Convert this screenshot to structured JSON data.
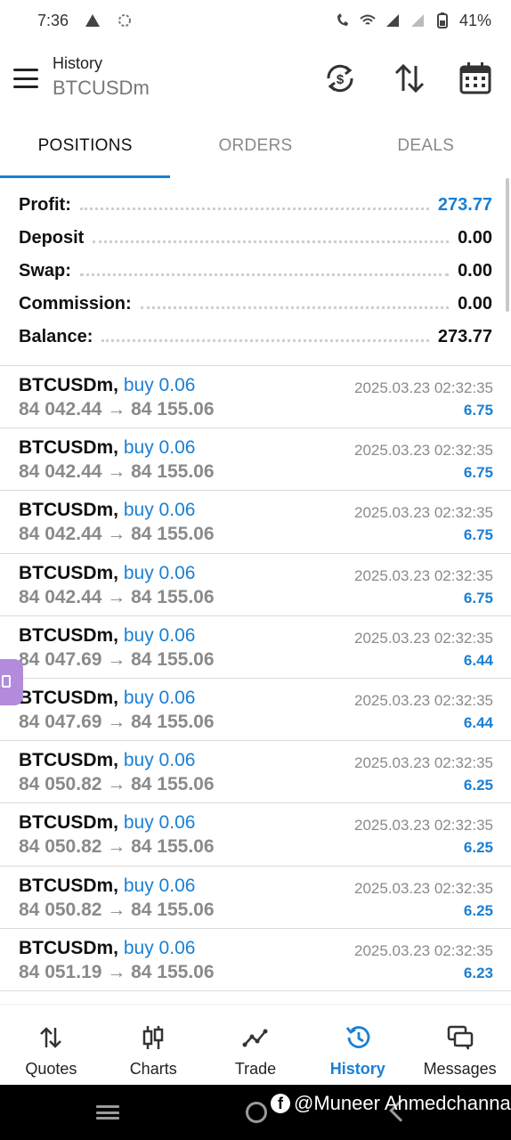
{
  "status_bar": {
    "time": "7:36",
    "battery": "41%"
  },
  "app_bar": {
    "subtitle": "History",
    "title": "BTCUSDm"
  },
  "tabs": [
    {
      "label": "POSITIONS",
      "active": true
    },
    {
      "label": "ORDERS",
      "active": false
    },
    {
      "label": "DEALS",
      "active": false
    }
  ],
  "summary": {
    "profit_label": "Profit:",
    "profit_value": "273.77",
    "deposit_label": "Deposit",
    "deposit_value": "0.00",
    "swap_label": "Swap:",
    "swap_value": "0.00",
    "commission_label": "Commission:",
    "commission_value": "0.00",
    "balance_label": "Balance:",
    "balance_value": "273.77"
  },
  "trades": [
    {
      "symbol": "BTCUSDm,",
      "side": "buy 0.06",
      "prices": "84 042.44 → 84 155.06",
      "date": "2025.03.23 02:32:35",
      "profit": "6.75"
    },
    {
      "symbol": "BTCUSDm,",
      "side": "buy 0.06",
      "prices": "84 042.44 → 84 155.06",
      "date": "2025.03.23 02:32:35",
      "profit": "6.75"
    },
    {
      "symbol": "BTCUSDm,",
      "side": "buy 0.06",
      "prices": "84 042.44 → 84 155.06",
      "date": "2025.03.23 02:32:35",
      "profit": "6.75"
    },
    {
      "symbol": "BTCUSDm,",
      "side": "buy 0.06",
      "prices": "84 042.44 → 84 155.06",
      "date": "2025.03.23 02:32:35",
      "profit": "6.75"
    },
    {
      "symbol": "BTCUSDm,",
      "side": "buy 0.06",
      "prices": "84 047.69 → 84 155.06",
      "date": "2025.03.23 02:32:35",
      "profit": "6.44"
    },
    {
      "symbol": "BTCUSDm,",
      "side": "buy 0.06",
      "prices": "84 047.69 → 84 155.06",
      "date": "2025.03.23 02:32:35",
      "profit": "6.44"
    },
    {
      "symbol": "BTCUSDm,",
      "side": "buy 0.06",
      "prices": "84 050.82 → 84 155.06",
      "date": "2025.03.23 02:32:35",
      "profit": "6.25"
    },
    {
      "symbol": "BTCUSDm,",
      "side": "buy 0.06",
      "prices": "84 050.82 → 84 155.06",
      "date": "2025.03.23 02:32:35",
      "profit": "6.25"
    },
    {
      "symbol": "BTCUSDm,",
      "side": "buy 0.06",
      "prices": "84 050.82 → 84 155.06",
      "date": "2025.03.23 02:32:35",
      "profit": "6.25"
    },
    {
      "symbol": "BTCUSDm,",
      "side": "buy 0.06",
      "prices": "84 051.19 → 84 155.06",
      "date": "2025.03.23 02:32:35",
      "profit": "6.23"
    }
  ],
  "bottom_nav": [
    {
      "label": "Quotes",
      "icon": "quotes-icon",
      "active": false
    },
    {
      "label": "Charts",
      "icon": "charts-icon",
      "active": false
    },
    {
      "label": "Trade",
      "icon": "trade-icon",
      "active": false
    },
    {
      "label": "History",
      "icon": "history-icon",
      "active": true
    },
    {
      "label": "Messages",
      "icon": "messages-icon",
      "active": false
    }
  ],
  "watermark": {
    "text": "@Muneer Ahmedchanna"
  },
  "colors": {
    "accent": "#1a7fd4",
    "muted": "#8a8a8a",
    "float_tab": "#b38bdc"
  }
}
